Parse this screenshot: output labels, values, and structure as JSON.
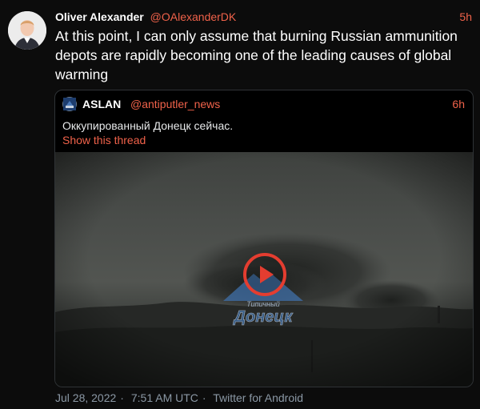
{
  "tweet": {
    "author_name": "Oliver Alexander",
    "author_handle": "@OAlexanderDK",
    "time": "5h",
    "text": "At this point, I can only assume that burning Russian ammunition depots are rapidly becoming one of the leading causes of global warming"
  },
  "quoted_tweet": {
    "author_name": "ASLAN",
    "author_handle": "@antiputler_news",
    "time": "6h",
    "text": "Оккупированный Донецк сейчас.",
    "show_thread_label": "Show this thread",
    "media": {
      "type": "video",
      "watermark_small": "Типичный",
      "watermark_large": "Донецк"
    }
  },
  "footer": {
    "date": "Jul 28, 2022",
    "separator": "·",
    "time": "7:51 AM UTC",
    "client": "Twitter for Android"
  },
  "colors": {
    "background": "#0c0c0c",
    "accent": "#f0624a",
    "play_button": "#e43d30"
  }
}
